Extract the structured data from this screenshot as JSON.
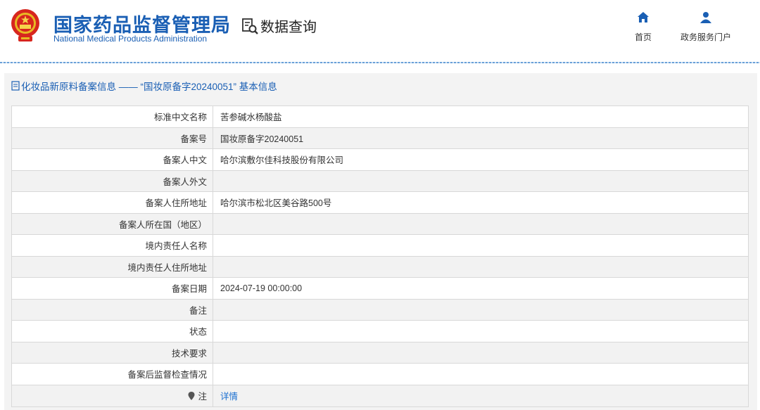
{
  "header": {
    "org_name_cn": "国家药品监督管理局",
    "org_name_en": "National Medical Products Administration",
    "query_title": "数据查询",
    "nav": [
      {
        "label": "首页",
        "icon": "home-icon"
      },
      {
        "label": "政务服务门户",
        "icon": "user-icon"
      }
    ],
    "brand_color": "#1a5fb4"
  },
  "section_title": "化妆品新原料备案信息 —— “国妆原备字20240051” 基本信息",
  "rows": [
    {
      "label": "标准中文名称",
      "value": "苦参碱水杨酸盐"
    },
    {
      "label": "备案号",
      "value": "国妆原备字20240051"
    },
    {
      "label": "备案人中文",
      "value": "哈尔滨敷尔佳科技股份有限公司"
    },
    {
      "label": "备案人外文",
      "value": ""
    },
    {
      "label": "备案人住所地址",
      "value": "哈尔滨市松北区美谷路500号"
    },
    {
      "label": "备案人所在国（地区）",
      "value": ""
    },
    {
      "label": "境内责任人名称",
      "value": ""
    },
    {
      "label": "境内责任人住所地址",
      "value": ""
    },
    {
      "label": "备案日期",
      "value": "2024-07-19 00:00:00"
    },
    {
      "label": "备注",
      "value": ""
    },
    {
      "label": "状态",
      "value": ""
    },
    {
      "label": "技术要求",
      "value": ""
    },
    {
      "label": "备案后监督检查情况",
      "value": ""
    },
    {
      "label": "注",
      "value": "详情",
      "icon": "pin-icon"
    }
  ]
}
